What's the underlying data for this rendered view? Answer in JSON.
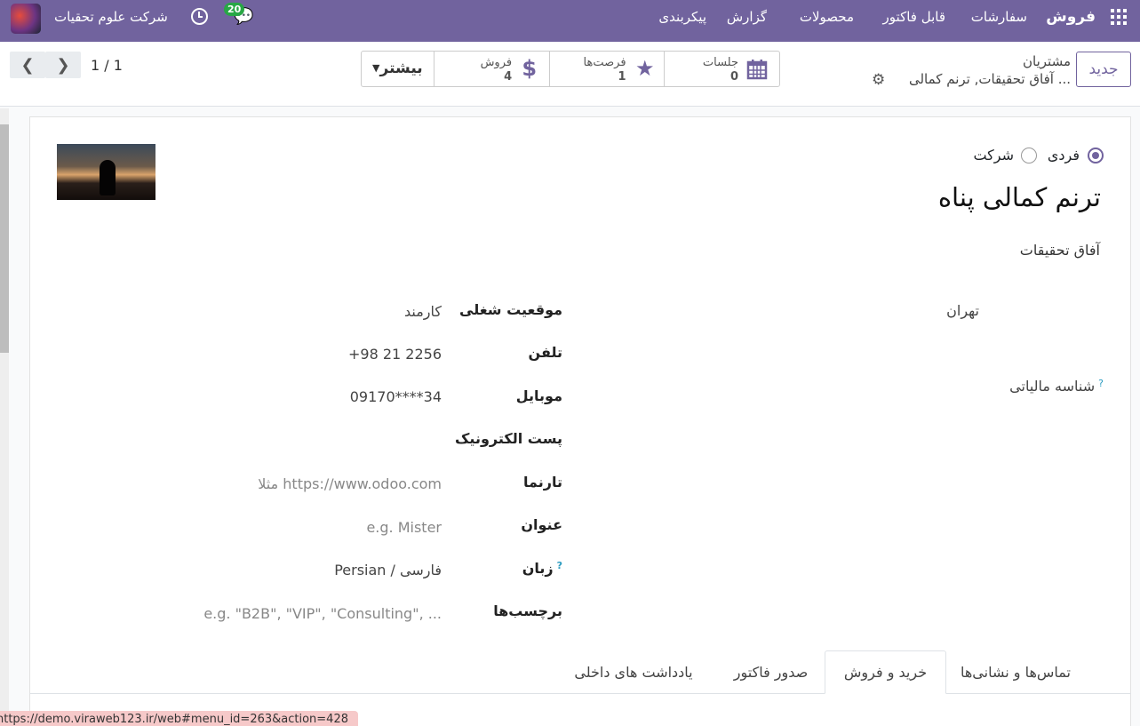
{
  "navbar": {
    "brand": "فروش",
    "menu": [
      "سفارشات",
      "قابل فاکتور",
      "محصولات",
      "گزارش",
      "پیکربندی"
    ],
    "company": "شرکت علوم تحقیات",
    "messages_count": "20"
  },
  "control_panel": {
    "new_button": "جدید",
    "breadcrumb_parent": "مشتریان",
    "breadcrumb_current": "آفاق تحقیقات, ترنم کمالی ...",
    "smart_buttons": {
      "meetings": {
        "label": "جلسات",
        "value": "0"
      },
      "opportunities": {
        "label": "فرصت‌ها",
        "value": "1"
      },
      "sales": {
        "label": "فروش",
        "value": "4"
      },
      "more": "بیشتر"
    },
    "pager": "1 / 1"
  },
  "form": {
    "type_individual": "فردی",
    "type_company": "شرکت",
    "name": "ترنم کمالی پناه",
    "parent_company": "آفاق تحقیقات",
    "city": "تهران",
    "tax_id_label": "شناسه مالیاتی",
    "tax_id_help": "?",
    "fields": [
      {
        "label": "موقعیت شغلی",
        "value": "کارمند",
        "placeholder": false
      },
      {
        "label": "تلفن",
        "value": "+98 21 2256",
        "placeholder": false
      },
      {
        "label": "موبایل",
        "value": "09170****34",
        "placeholder": false
      },
      {
        "label": "پست الکترونیک",
        "value": "",
        "placeholder": false
      },
      {
        "label": "تارنما",
        "value": "مثلا https://www.odoo.com",
        "placeholder": true
      },
      {
        "label": "عنوان",
        "value": "e.g. Mister",
        "placeholder": true
      },
      {
        "label": "زبان",
        "value": "Persian / فارسی",
        "placeholder": false
      },
      {
        "label": "برچسب‌ها",
        "value": "e.g. \"B2B\", \"VIP\", \"Consulting\", ...",
        "placeholder": true
      }
    ],
    "language_help": "?"
  },
  "tabs": [
    "تماس‌ها و نشانی‌ها",
    "خرید و فروش",
    "صدور فاکتور",
    "یادداشت های داخلی"
  ],
  "status_url": "https://demo.viraweb123.ir/web#menu_id=263&action=428"
}
